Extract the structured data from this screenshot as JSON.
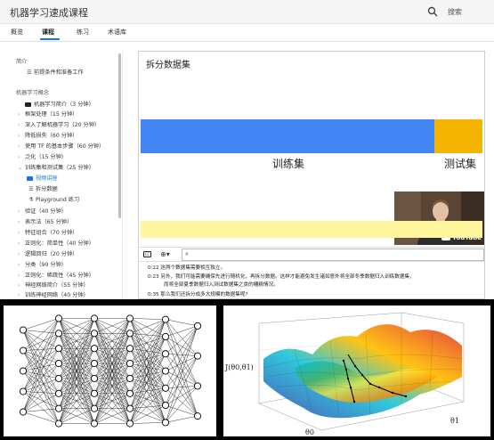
{
  "header": {
    "title": "机器学习速成课程",
    "search_label": "搜索"
  },
  "tabs": [
    {
      "label": "概览",
      "active": false
    },
    {
      "label": "课程",
      "active": true
    },
    {
      "label": "练习",
      "active": false
    },
    {
      "label": "术语库",
      "active": false
    }
  ],
  "sidebar": {
    "intro_heading": "简介",
    "prereq": "前提条件和准备工作",
    "concepts_heading": "机器学习概念",
    "items": [
      {
        "label": "机器学习简介（3 分钟）",
        "icon": "youtube-icon"
      },
      {
        "label": "框架处理（15 分钟）"
      },
      {
        "label": "深入了解机器学习（20 分钟）"
      },
      {
        "label": "降低损失（60 分钟）"
      },
      {
        "label": "使用 TF 的基本步骤（60 分钟）"
      },
      {
        "label": "泛化（15 分钟）"
      },
      {
        "label": "训练集和测试集（25 分钟）",
        "expanded": true
      },
      {
        "label": "视频讲座",
        "sub": true,
        "active": true,
        "icon": "youtube-icon"
      },
      {
        "label": "拆分数据",
        "sub": true,
        "icon": "document-icon"
      },
      {
        "label": "Playground 练习",
        "sub": true,
        "icon": "flask-icon"
      },
      {
        "label": "验证（40 分钟）"
      },
      {
        "label": "表示法（65 分钟）"
      },
      {
        "label": "特征组合（70 分钟）"
      },
      {
        "label": "正则化：简单性（40 分钟）"
      },
      {
        "label": "逻辑回归（20 分钟）"
      },
      {
        "label": "分类（90 分钟）"
      },
      {
        "label": "正则化：稀疏性（45 分钟）"
      },
      {
        "label": "神经网络简介（55 分钟）"
      },
      {
        "label": "训练神经网络（40 分钟）"
      }
    ]
  },
  "video": {
    "title": "拆分数据集",
    "train_label": "训练集",
    "test_label": "测试集",
    "youtube_label": "YouTube",
    "train_fraction": 0.86,
    "colors": {
      "train": "#4285f4",
      "test": "#f4b400"
    }
  },
  "transcript": {
    "lines": [
      {
        "time": "0:22",
        "text": "这两个数据集需要相互独立。"
      },
      {
        "time": "0:23",
        "text": "另外，我们可能需要确保先进行随机化，再拆分数据。这样才能避免发生诸如意外将全部冬季数据归入训练数据集，"
      },
      {
        "time": "",
        "text": "而将全部夏季数据归入测试数据集之类的糟糕情况。"
      },
      {
        "time": "0:35",
        "text": "那么我们还拆分成多大规模的数据集呢?"
      }
    ]
  },
  "loss_plot": {
    "zlabel": "J(θ0,θ1)",
    "xlabel": "θ0",
    "ylabel": "θ1"
  }
}
